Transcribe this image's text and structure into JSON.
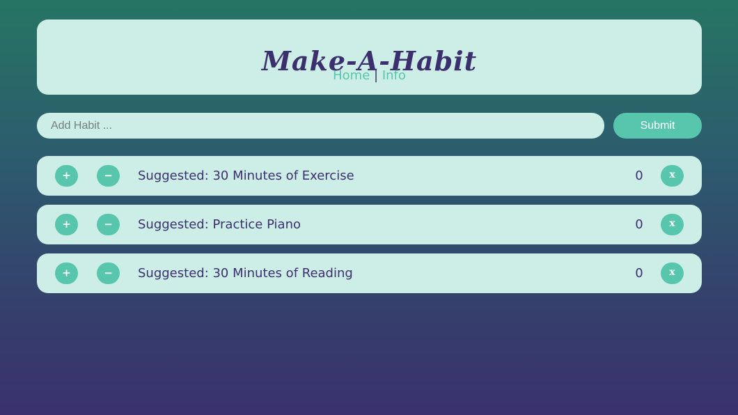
{
  "header": {
    "title": "Make-A-Habit",
    "nav": {
      "home_label": "Home",
      "separator": "|",
      "info_label": "Info"
    }
  },
  "form": {
    "placeholder": "Add Habit ...",
    "value": "",
    "submit_label": "Submit"
  },
  "habits": [
    {
      "plus_label": "+",
      "minus_label": "−",
      "name": "Suggested: 30 Minutes of Exercise",
      "count": "0",
      "delete_label": "x"
    },
    {
      "plus_label": "+",
      "minus_label": "−",
      "name": "Suggested: Practice Piano",
      "count": "0",
      "delete_label": "x"
    },
    {
      "plus_label": "+",
      "minus_label": "−",
      "name": "Suggested: 30 Minutes of Reading",
      "count": "0",
      "delete_label": "x"
    }
  ],
  "colors": {
    "panel": "#cdeee6",
    "accent": "#57c6ac",
    "text": "#3c2f6d",
    "background_top": "#267563",
    "background_bottom": "#3a316e"
  }
}
